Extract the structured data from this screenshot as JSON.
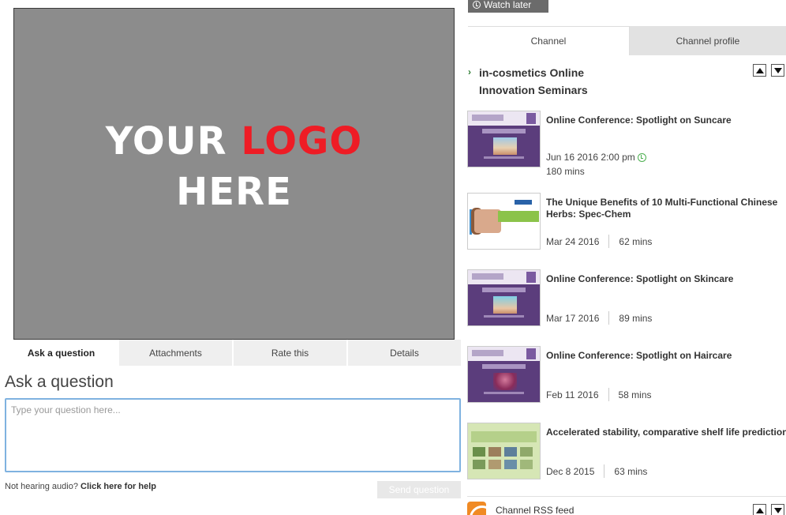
{
  "player": {
    "logo_line1_white": "YOUR",
    "logo_line1_red": "LOGO",
    "logo_line2": "HERE",
    "logo_red_color": "#ee1c25"
  },
  "question_tabs": [
    {
      "label": "Ask a question",
      "active": true
    },
    {
      "label": "Attachments",
      "active": false
    },
    {
      "label": "Rate this",
      "active": false
    },
    {
      "label": "Details",
      "active": false
    }
  ],
  "ask": {
    "title": "Ask a question",
    "placeholder": "Type your question here...",
    "audio_help_prefix": "Not hearing audio?",
    "audio_help_link": "Click here for help",
    "send_label": "Send question"
  },
  "watch_later": {
    "label": "Watch later",
    "icon": "clock-icon"
  },
  "channel_tabs": [
    {
      "label": "Channel",
      "active": true
    },
    {
      "label": "Channel profile",
      "active": false
    }
  ],
  "channel": {
    "name": "in-cosmetics Online Innovation Seminars",
    "accent": "#2e7d32"
  },
  "items": [
    {
      "title": "Online Conference: Spotlight on Suncare",
      "date": "Jun 16 2016 2:00 pm",
      "duration": "180 mins",
      "upcoming": true,
      "thumb": "purple"
    },
    {
      "title": "The Unique Benefits of 10 Multi-Functional Chinese Herbs: Spec-Chem",
      "date": "Mar 24 2016",
      "duration": "62 mins",
      "upcoming": false,
      "thumb": "white"
    },
    {
      "title": "Online Conference: Spotlight on Skincare",
      "date": "Mar 17 2016",
      "duration": "89 mins",
      "upcoming": false,
      "thumb": "purple"
    },
    {
      "title": "Online Conference: Spotlight on Haircare",
      "date": "Feb 11 2016",
      "duration": "58 mins",
      "upcoming": false,
      "thumb": "purple"
    },
    {
      "title": "Accelerated stability, comparative shelf life prediction for cosmetic products",
      "date": "Dec 8 2015",
      "duration": "63 mins",
      "upcoming": false,
      "thumb": "green"
    }
  ],
  "rss": {
    "label": "Channel RSS feed",
    "icon": "rss-icon"
  }
}
